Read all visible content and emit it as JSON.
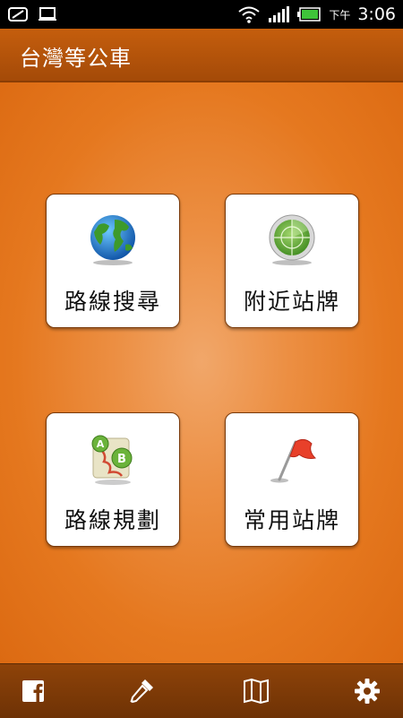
{
  "status_bar": {
    "ampm": "下午",
    "time": "3:06"
  },
  "app": {
    "title": "台灣等公車"
  },
  "tiles": [
    {
      "label": "路線搜尋",
      "icon": "globe-icon"
    },
    {
      "label": "附近站牌",
      "icon": "radar-icon"
    },
    {
      "label": "路線規劃",
      "icon": "route-map-icon"
    },
    {
      "label": "常用站牌",
      "icon": "flag-icon"
    }
  ],
  "toolbar": {
    "icons": [
      "facebook-icon",
      "dropper-icon",
      "map-icon",
      "settings-icon"
    ]
  },
  "colors": {
    "accent": "#e2741a",
    "title_bar": "#b0520a",
    "toolbar": "#7d3a07"
  }
}
